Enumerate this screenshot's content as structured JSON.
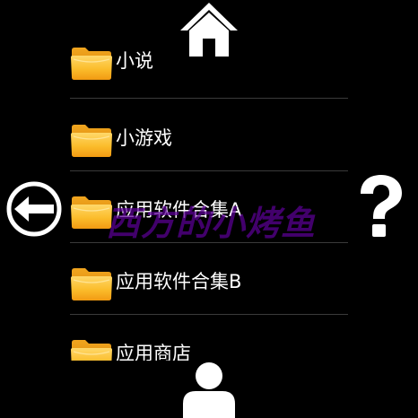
{
  "file_list": {
    "items": [
      {
        "label": "小说",
        "icon": "folder-icon"
      },
      {
        "label": "小游戏",
        "icon": "folder-icon"
      },
      {
        "label": "应用软件合集A",
        "icon": "folder-icon"
      },
      {
        "label": "应用软件合集B",
        "icon": "folder-icon"
      },
      {
        "label": "应用商店",
        "icon": "folder-icon"
      }
    ]
  },
  "watermark_text": "西方的小烤鱼",
  "nav": {
    "home": {
      "icon": "home-icon"
    },
    "back": {
      "icon": "back-arrow-icon"
    },
    "help": {
      "icon": "help-icon"
    },
    "user": {
      "icon": "user-icon"
    }
  },
  "colors": {
    "background": "#000000",
    "text": "#ffffff",
    "folder": "#f7b52a",
    "divider": "#3a3a3a",
    "watermark": "#5c0096"
  }
}
